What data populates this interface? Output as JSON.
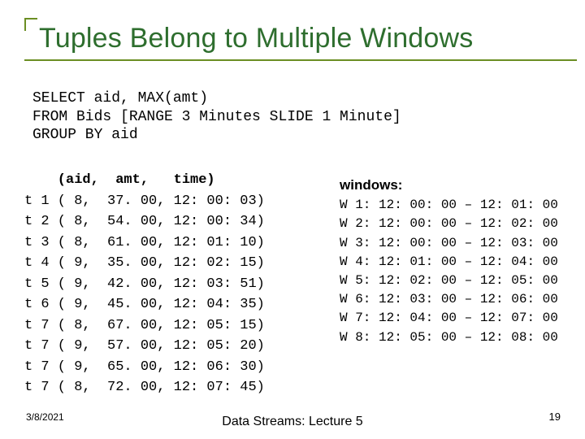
{
  "title": "Tuples Belong to Multiple Windows",
  "sql": "SELECT aid, MAX(amt)\nFROM Bids [RANGE 3 Minutes SLIDE 1 Minute]\nGROUP BY aid",
  "tuples": {
    "header": "    (aid,  amt,   time)",
    "rows": [
      "t 1 ( 8,  37. 00, 12: 00: 03)",
      "t 2 ( 8,  54. 00, 12: 00: 34)",
      "t 3 ( 8,  61. 00, 12: 01: 10)",
      "t 4 ( 9,  35. 00, 12: 02: 15)",
      "t 5 ( 9,  42. 00, 12: 03: 51)",
      "t 6 ( 9,  45. 00, 12: 04: 35)",
      "t 7 ( 8,  67. 00, 12: 05: 15)",
      "t 7 ( 9,  57. 00, 12: 05: 20)",
      "t 7 ( 9,  65. 00, 12: 06: 30)",
      "t 7 ( 8,  72. 00, 12: 07: 45)"
    ]
  },
  "windows": {
    "header": "windows:",
    "rows": [
      "W 1: 12: 00: 00 – 12: 01: 00",
      "W 2: 12: 00: 00 – 12: 02: 00",
      "W 3: 12: 00: 00 – 12: 03: 00",
      "W 4: 12: 01: 00 – 12: 04: 00",
      "W 5: 12: 02: 00 – 12: 05: 00",
      "W 6: 12: 03: 00 – 12: 06: 00",
      "W 7: 12: 04: 00 – 12: 07: 00",
      "W 8: 12: 05: 00 – 12: 08: 00"
    ]
  },
  "footer": {
    "date": "3/8/2021",
    "center": "Data Streams: Lecture\n5",
    "page": "19"
  }
}
